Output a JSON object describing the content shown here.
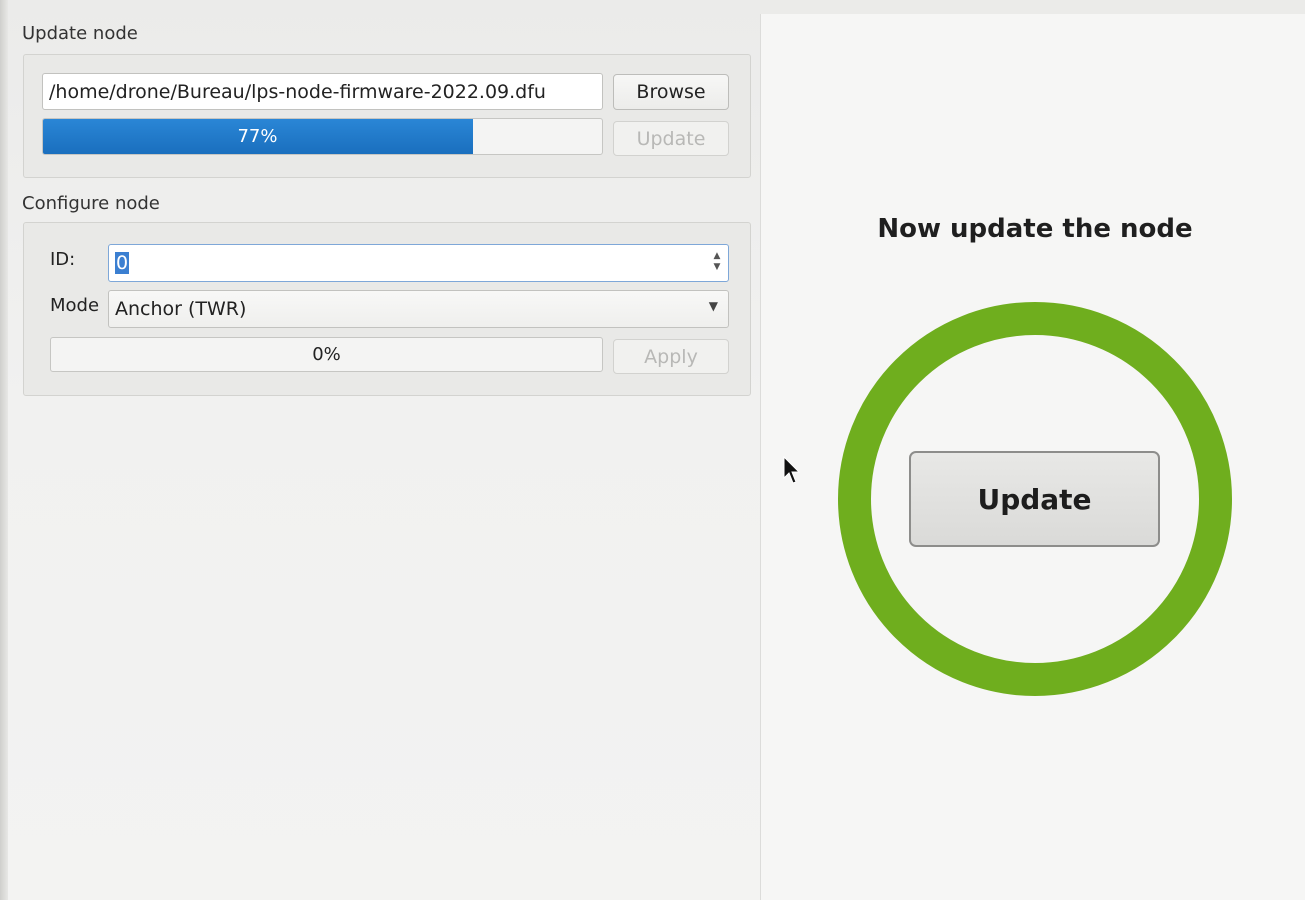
{
  "update_node": {
    "title": "Update node",
    "file_path": "/home/drone/Bureau/lps-node-firmware-2022.09.dfu",
    "browse_label": "Browse",
    "progress_value": 77,
    "progress_text": "77%",
    "update_label": "Update"
  },
  "configure_node": {
    "title": "Configure node",
    "id_label": "ID:",
    "id_value": "0",
    "mode_label": "Mode",
    "mode_value": "Anchor (TWR)",
    "progress_value": 0,
    "progress_text": "0%",
    "apply_label": "Apply"
  },
  "wizard": {
    "instruction": "Now update the node",
    "update_button_label": "Update",
    "ring_color": "#6fae1e"
  },
  "colors": {
    "progress_blue": "#1a6fbe"
  }
}
